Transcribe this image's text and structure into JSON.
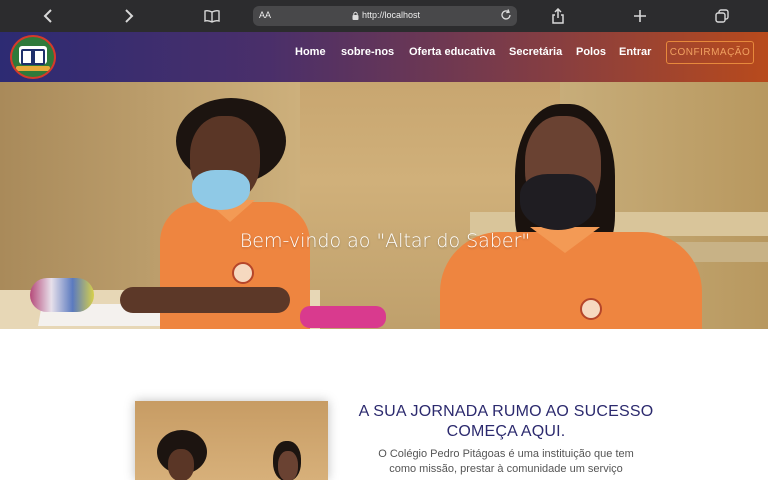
{
  "browser": {
    "url": "http://localhost",
    "text_size_label": "AA"
  },
  "header": {
    "nav": [
      "Home",
      "sobre-nos",
      "Oferta educativa",
      "Secretária",
      "Polos",
      "Entrar"
    ],
    "confirm_label": "CONFIRMAÇÃO"
  },
  "hero": {
    "title": "Bem-vindo ao \"Altar do Saber\""
  },
  "intro": {
    "heading_line1": "A SUA JORNADA RUMO AO SUCESSO",
    "heading_line2": "COMEÇA AQUI.",
    "para_line1": "O Colégio Pedro Pitágoas é uma instituição que tem",
    "para_line2": "como missão, prestar à comunidade um serviço"
  },
  "colors": {
    "header_start": "#2d2b73",
    "header_end": "#b84a1c",
    "accent_orange": "#e7893c",
    "heading_navy": "#2c2a6e"
  }
}
